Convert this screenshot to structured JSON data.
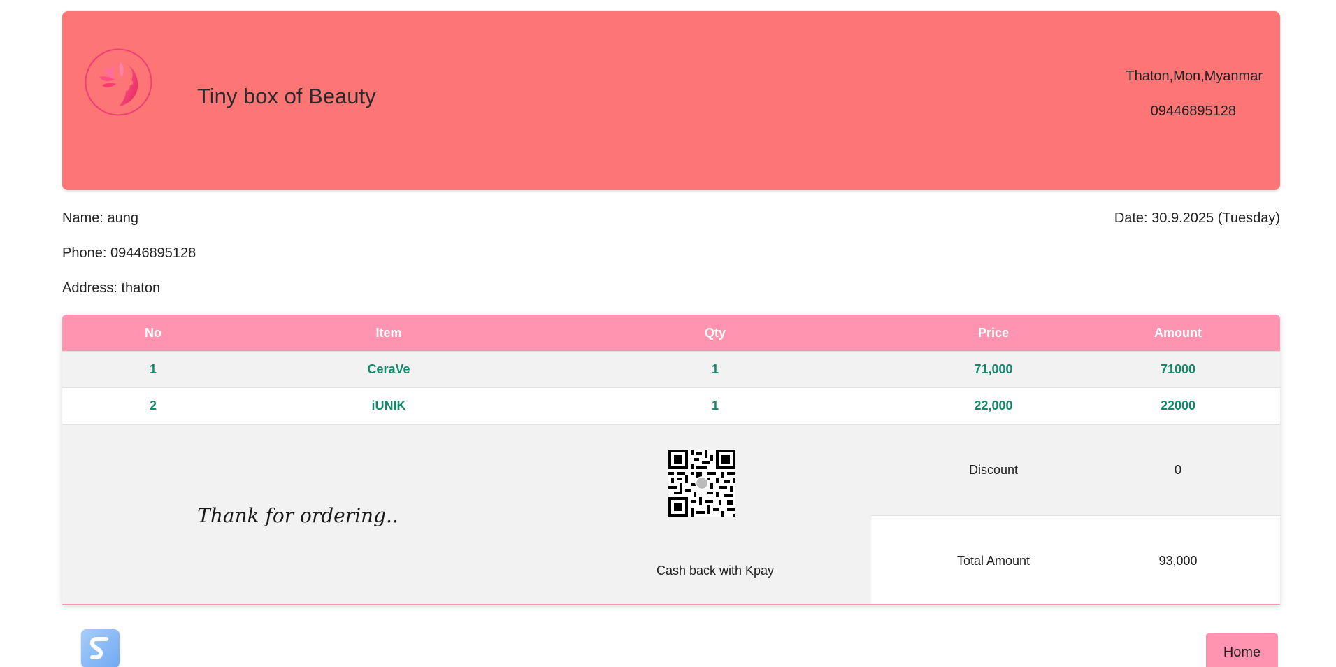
{
  "shop": {
    "name": "Tiny box of Beauty",
    "address": "Thaton,Mon,Myanmar",
    "phone": "09446895128",
    "logo_icon": "woman-face-logo-icon"
  },
  "customer": {
    "name_line": "Name: aung",
    "phone_line": "Phone: 09446895128",
    "address_line": "Address: thaton",
    "date_line": "Date: 30.9.2025 (Tuesday)"
  },
  "table": {
    "headers": [
      "No",
      "Item",
      "Qty",
      "Price",
      "Amount"
    ],
    "rows": [
      {
        "no": "1",
        "item": "CeraVe",
        "qty": "1",
        "price": "71,000",
        "amount": "71000"
      },
      {
        "no": "2",
        "item": "iUNIK",
        "qty": "1",
        "price": "22,000",
        "amount": "22000"
      }
    ]
  },
  "footer": {
    "thanks": "Thank for ordering..",
    "qr_icon": "qr-code-icon",
    "kpay": "Cash back with Kpay",
    "discount_label": "Discount",
    "discount_value": "0",
    "total_label": "Total Amount",
    "total_value": "93,000"
  },
  "actions": {
    "home_label": "Home",
    "corner_icon": "app-logo-icon"
  },
  "colors": {
    "header_bg": "#fd7575",
    "table_header_bg": "#ff94b0",
    "cell_text": "#11896a",
    "home_button_bg": "#ff94b0"
  }
}
